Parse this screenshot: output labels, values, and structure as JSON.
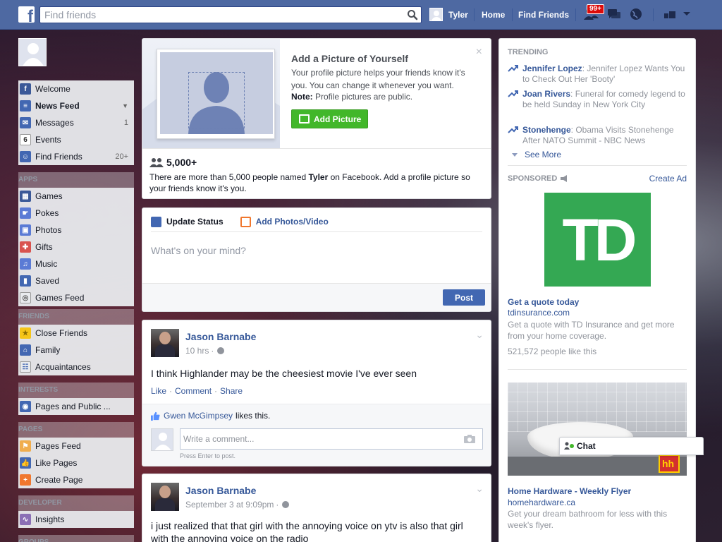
{
  "topbar": {
    "logo_letter": "f",
    "search_placeholder": "Find friends",
    "user_name": "Tyler",
    "home": "Home",
    "find_friends": "Find Friends",
    "badge_count": "99+"
  },
  "sidebar": {
    "main": [
      {
        "label": "Welcome",
        "count": "",
        "icon": "facebook-icon",
        "color": "#3b5998"
      },
      {
        "label": "News Feed",
        "count": "",
        "icon": "news-feed-icon",
        "color": "#4267b2"
      },
      {
        "label": "Messages",
        "count": "1",
        "icon": "messages-icon",
        "color": "#4267b2"
      },
      {
        "label": "Events",
        "count": "",
        "icon": "calendar-icon",
        "color": "#ffffff"
      },
      {
        "label": "Find Friends",
        "count": "20+",
        "icon": "find-friends-icon",
        "color": "#4267b2"
      }
    ],
    "sections": {
      "apps": "APPS",
      "friends": "FRIENDS",
      "interests": "INTERESTS",
      "pages": "PAGES",
      "developer": "DEVELOPER",
      "groups": "GROUPS"
    },
    "apps": [
      "Games",
      "Pokes",
      "Photos",
      "Gifts",
      "Music",
      "Saved",
      "Games Feed"
    ],
    "friends": [
      "Close Friends",
      "Family",
      "Acquaintances"
    ],
    "interests": [
      "Pages and Public ..."
    ],
    "pages": [
      "Pages Feed",
      "Like Pages",
      "Create Page"
    ],
    "developer": [
      "Insights"
    ]
  },
  "profile_prompt": {
    "title": "Add a Picture of Yourself",
    "desc": "Your profile picture helps your friends know it's you. You can change it whenever you want.",
    "note_label": "Note:",
    "note_text": " Profile pictures are public.",
    "button": "Add Picture",
    "close": "×",
    "count": "5,000+",
    "name_prefix": "There are more than 5,000 people named ",
    "name": "Tyler",
    "name_suffix": " on Facebook. Add a profile picture so your friends know it's you."
  },
  "composer": {
    "tab_status": "Update Status",
    "tab_photos": "Add Photos/Video",
    "placeholder": "What's on your mind?",
    "post_button": "Post"
  },
  "posts": [
    {
      "author": "Jason Barnabe",
      "time": "10 hrs",
      "text": "I think Highlander may be the cheesiest movie I've ever seen",
      "actions": [
        "Like",
        "Comment",
        "Share"
      ],
      "liker": "Gwen McGimpsey",
      "likes_text": "likes this.",
      "comment_placeholder": "Write a comment...",
      "comment_hint": "Press Enter to post."
    },
    {
      "author": "Jason Barnabe",
      "time": "September 3 at 9:09pm",
      "text": "i just realized that that girl with the annoying voice on ytv is also that girl with the annoying voice on the radio"
    }
  ],
  "trending": {
    "heading": "TRENDING",
    "items": [
      {
        "topic": "Jennifer Lopez",
        "text": ": Jennifer Lopez Wants You to Check Out Her 'Booty'"
      },
      {
        "topic": "Joan Rivers",
        "text": ": Funeral for comedy legend to be held Sunday in New York City"
      },
      {
        "topic": "Stonehenge",
        "text": ": Obama Visits Stonehenge After NATO Summit - NBC News"
      }
    ],
    "see_more": "See More"
  },
  "sponsored": {
    "heading": "SPONSORED",
    "create_ad": "Create Ad",
    "ads": [
      {
        "logo_text": "TD",
        "title": "Get a quote today",
        "url": "tdinsurance.com",
        "desc": "Get a quote with TD Insurance and get more from your home coverage.",
        "social": "521,572 people like this"
      },
      {
        "logo_text": "hh",
        "title": "Home Hardware - Weekly Flyer",
        "url": "homehardware.ca",
        "desc": "Get your dream bathroom for less with this week's flyer."
      }
    ]
  },
  "chat": {
    "label": "Chat"
  }
}
